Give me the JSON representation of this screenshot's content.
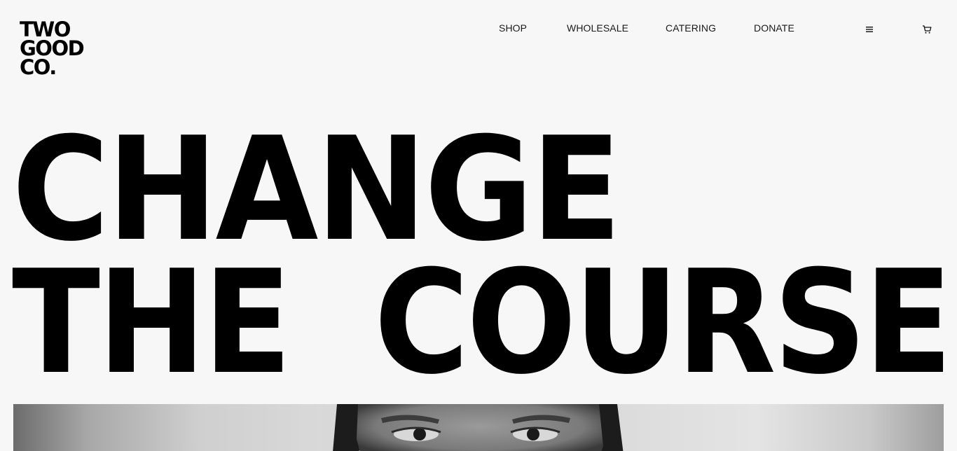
{
  "brand": {
    "logo_lines": [
      "TWO",
      "GOOD",
      "CO."
    ]
  },
  "nav": {
    "items": [
      {
        "label": "SHOP"
      },
      {
        "label": "WHOLESALE"
      },
      {
        "label": "CATERING"
      },
      {
        "label": "DONATE"
      }
    ]
  },
  "header_icons": {
    "menu_icon": "hamburger-menu-icon",
    "cart_icon": "shopping-cart-icon"
  },
  "hero": {
    "line1": "CHANGE",
    "line2": "THE  COURSE"
  },
  "hero_image": {
    "kind": "black-and-white portrait photo"
  },
  "colors": {
    "background": "#f7f7f7",
    "text": "#000000",
    "nav_text": "#1a1a1a"
  }
}
